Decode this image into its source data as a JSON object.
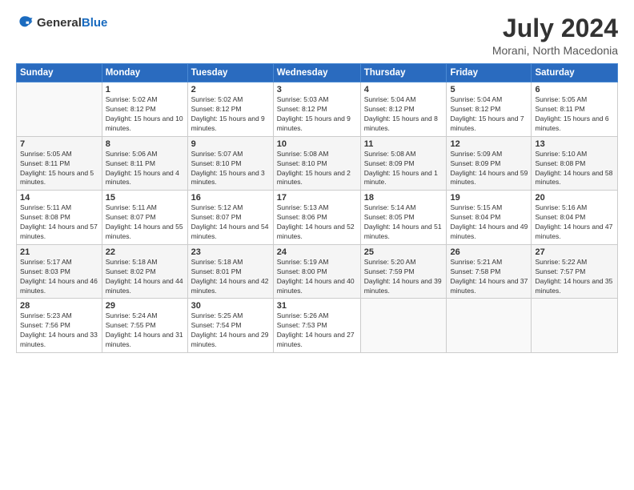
{
  "header": {
    "logo_general": "General",
    "logo_blue": "Blue",
    "month_year": "July 2024",
    "location": "Morani, North Macedonia"
  },
  "days_of_week": [
    "Sunday",
    "Monday",
    "Tuesday",
    "Wednesday",
    "Thursday",
    "Friday",
    "Saturday"
  ],
  "weeks": [
    [
      {
        "day": "",
        "sunrise": "",
        "sunset": "",
        "daylight": ""
      },
      {
        "day": "1",
        "sunrise": "5:02 AM",
        "sunset": "8:12 PM",
        "daylight": "15 hours and 10 minutes."
      },
      {
        "day": "2",
        "sunrise": "5:02 AM",
        "sunset": "8:12 PM",
        "daylight": "15 hours and 9 minutes."
      },
      {
        "day": "3",
        "sunrise": "5:03 AM",
        "sunset": "8:12 PM",
        "daylight": "15 hours and 9 minutes."
      },
      {
        "day": "4",
        "sunrise": "5:04 AM",
        "sunset": "8:12 PM",
        "daylight": "15 hours and 8 minutes."
      },
      {
        "day": "5",
        "sunrise": "5:04 AM",
        "sunset": "8:12 PM",
        "daylight": "15 hours and 7 minutes."
      },
      {
        "day": "6",
        "sunrise": "5:05 AM",
        "sunset": "8:11 PM",
        "daylight": "15 hours and 6 minutes."
      }
    ],
    [
      {
        "day": "7",
        "sunrise": "5:05 AM",
        "sunset": "8:11 PM",
        "daylight": "15 hours and 5 minutes."
      },
      {
        "day": "8",
        "sunrise": "5:06 AM",
        "sunset": "8:11 PM",
        "daylight": "15 hours and 4 minutes."
      },
      {
        "day": "9",
        "sunrise": "5:07 AM",
        "sunset": "8:10 PM",
        "daylight": "15 hours and 3 minutes."
      },
      {
        "day": "10",
        "sunrise": "5:08 AM",
        "sunset": "8:10 PM",
        "daylight": "15 hours and 2 minutes."
      },
      {
        "day": "11",
        "sunrise": "5:08 AM",
        "sunset": "8:09 PM",
        "daylight": "15 hours and 1 minute."
      },
      {
        "day": "12",
        "sunrise": "5:09 AM",
        "sunset": "8:09 PM",
        "daylight": "14 hours and 59 minutes."
      },
      {
        "day": "13",
        "sunrise": "5:10 AM",
        "sunset": "8:08 PM",
        "daylight": "14 hours and 58 minutes."
      }
    ],
    [
      {
        "day": "14",
        "sunrise": "5:11 AM",
        "sunset": "8:08 PM",
        "daylight": "14 hours and 57 minutes."
      },
      {
        "day": "15",
        "sunrise": "5:11 AM",
        "sunset": "8:07 PM",
        "daylight": "14 hours and 55 minutes."
      },
      {
        "day": "16",
        "sunrise": "5:12 AM",
        "sunset": "8:07 PM",
        "daylight": "14 hours and 54 minutes."
      },
      {
        "day": "17",
        "sunrise": "5:13 AM",
        "sunset": "8:06 PM",
        "daylight": "14 hours and 52 minutes."
      },
      {
        "day": "18",
        "sunrise": "5:14 AM",
        "sunset": "8:05 PM",
        "daylight": "14 hours and 51 minutes."
      },
      {
        "day": "19",
        "sunrise": "5:15 AM",
        "sunset": "8:04 PM",
        "daylight": "14 hours and 49 minutes."
      },
      {
        "day": "20",
        "sunrise": "5:16 AM",
        "sunset": "8:04 PM",
        "daylight": "14 hours and 47 minutes."
      }
    ],
    [
      {
        "day": "21",
        "sunrise": "5:17 AM",
        "sunset": "8:03 PM",
        "daylight": "14 hours and 46 minutes."
      },
      {
        "day": "22",
        "sunrise": "5:18 AM",
        "sunset": "8:02 PM",
        "daylight": "14 hours and 44 minutes."
      },
      {
        "day": "23",
        "sunrise": "5:18 AM",
        "sunset": "8:01 PM",
        "daylight": "14 hours and 42 minutes."
      },
      {
        "day": "24",
        "sunrise": "5:19 AM",
        "sunset": "8:00 PM",
        "daylight": "14 hours and 40 minutes."
      },
      {
        "day": "25",
        "sunrise": "5:20 AM",
        "sunset": "7:59 PM",
        "daylight": "14 hours and 39 minutes."
      },
      {
        "day": "26",
        "sunrise": "5:21 AM",
        "sunset": "7:58 PM",
        "daylight": "14 hours and 37 minutes."
      },
      {
        "day": "27",
        "sunrise": "5:22 AM",
        "sunset": "7:57 PM",
        "daylight": "14 hours and 35 minutes."
      }
    ],
    [
      {
        "day": "28",
        "sunrise": "5:23 AM",
        "sunset": "7:56 PM",
        "daylight": "14 hours and 33 minutes."
      },
      {
        "day": "29",
        "sunrise": "5:24 AM",
        "sunset": "7:55 PM",
        "daylight": "14 hours and 31 minutes."
      },
      {
        "day": "30",
        "sunrise": "5:25 AM",
        "sunset": "7:54 PM",
        "daylight": "14 hours and 29 minutes."
      },
      {
        "day": "31",
        "sunrise": "5:26 AM",
        "sunset": "7:53 PM",
        "daylight": "14 hours and 27 minutes."
      },
      {
        "day": "",
        "sunrise": "",
        "sunset": "",
        "daylight": ""
      },
      {
        "day": "",
        "sunrise": "",
        "sunset": "",
        "daylight": ""
      },
      {
        "day": "",
        "sunrise": "",
        "sunset": "",
        "daylight": ""
      }
    ]
  ]
}
